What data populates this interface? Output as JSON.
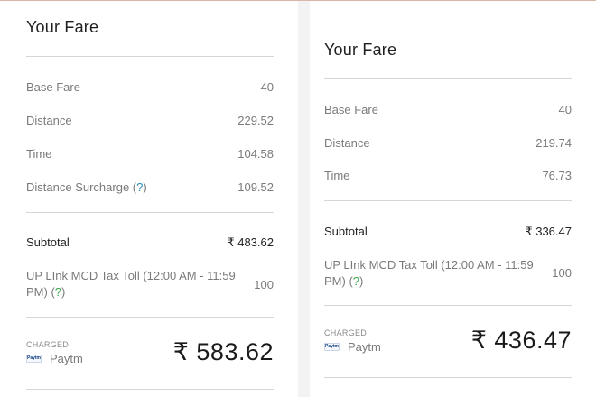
{
  "left": {
    "title": "Your Fare",
    "base_fare": {
      "label": "Base Fare",
      "value": "40"
    },
    "distance": {
      "label": "Distance",
      "value": "229.52"
    },
    "time": {
      "label": "Time",
      "value": "104.58"
    },
    "surcharge": {
      "label": "Distance Surcharge (",
      "help": "?",
      "close": ")",
      "value": "109.52"
    },
    "subtotal": {
      "label": "Subtotal",
      "value": "₹ 483.62"
    },
    "tax": {
      "label": "UP LInk MCD Tax Toll (12:00 AM - 11:59 PM) (",
      "help": "?",
      "close": ")",
      "value": "100"
    },
    "charged_label": "CHARGED",
    "payment_method": "Paytm",
    "payment_logo_text": "Paytm",
    "total": "₹ 583.62"
  },
  "right": {
    "title": "Your Fare",
    "base_fare": {
      "label": "Base Fare",
      "value": "40"
    },
    "distance": {
      "label": "Distance",
      "value": "219.74"
    },
    "time": {
      "label": "Time",
      "value": "76.73"
    },
    "subtotal": {
      "label": "Subtotal",
      "value": "₹ 336.47"
    },
    "tax": {
      "label": "UP LInk MCD Tax Toll (12:00 AM - 11:59 PM) (",
      "help": "?",
      "close": ")",
      "value": "100"
    },
    "charged_label": "CHARGED",
    "payment_method": "Paytm",
    "payment_logo_text": "Paytm",
    "total": "₹ 436.47"
  },
  "colors": {
    "help_link_blue": "#2c8fb6",
    "help_link_green": "#3aa64c",
    "divider": "#d6d6d6"
  }
}
